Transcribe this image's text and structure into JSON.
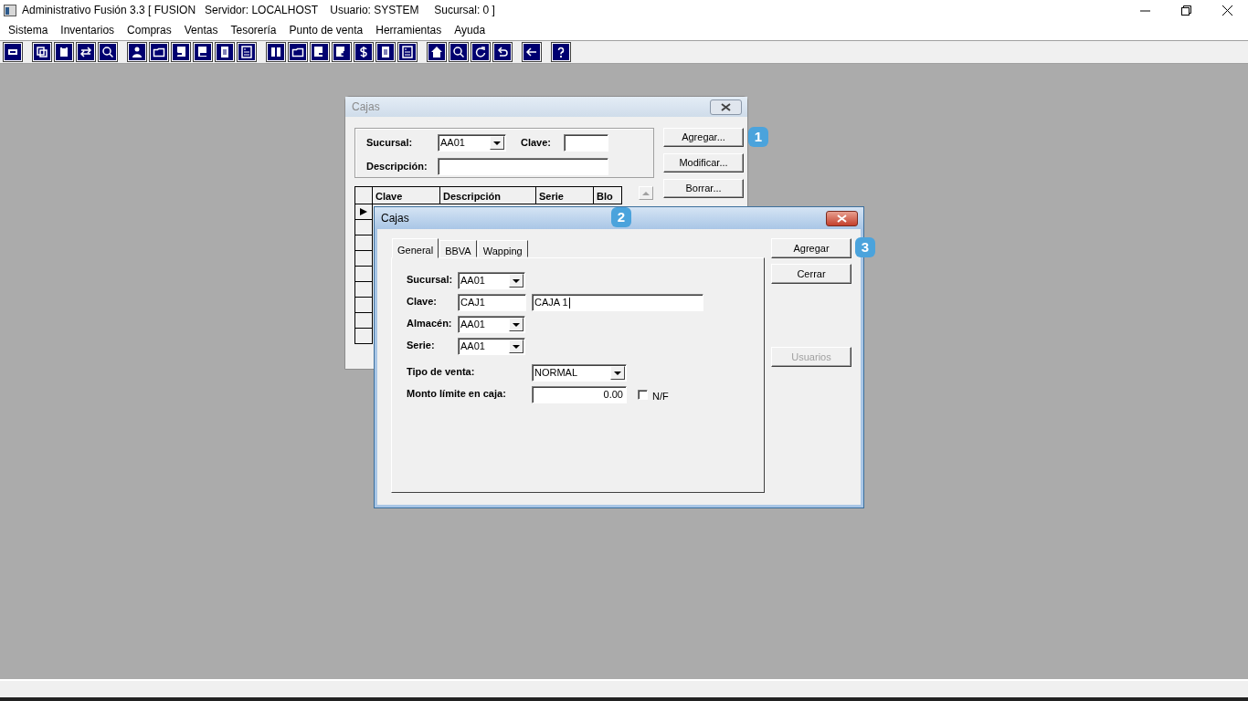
{
  "app": {
    "title": "Administrativo Fusión 3.3 [ FUSION   Servidor: LOCALHOST    Usuario: SYSTEM     Sucursal: 0 ]"
  },
  "menu": [
    "Sistema",
    "Inventarios",
    "Compras",
    "Ventas",
    "Tesorería",
    "Punto de venta",
    "Herramientas",
    "Ayuda"
  ],
  "list_window": {
    "title": "Cajas",
    "active": false,
    "filters": {
      "sucursal_label": "Sucursal:",
      "sucursal_value": "AA01",
      "clave_label": "Clave:",
      "descripcion_label": "Descripción:"
    },
    "buttons": [
      {
        "label": "Agregar...",
        "callout": "1"
      },
      {
        "label": "Modificar..."
      },
      {
        "label": "Borrar..."
      }
    ],
    "grid": {
      "columns": [
        "Clave",
        "Descripción",
        "Serie",
        "Blo"
      ],
      "rows": [
        {
          "current": true
        },
        {
          "current": false
        },
        {
          "current": false
        },
        {
          "current": false
        },
        {
          "current": false
        },
        {
          "current": false
        },
        {
          "current": false
        },
        {
          "current": false
        },
        {
          "current": false
        }
      ]
    }
  },
  "edit_window": {
    "title": "Cajas",
    "active": true,
    "callout": "2",
    "tabs": [
      {
        "label": "General",
        "selected": true
      },
      {
        "label": "BBVA",
        "selected": false
      },
      {
        "label": "Wapping",
        "selected": false
      }
    ],
    "fields": [
      {
        "kind": "select",
        "label": "Sucursal:",
        "value": "AA01"
      },
      {
        "kind": "text_pair",
        "label": "Clave:",
        "value": "CAJ1",
        "value_2": "CAJA 1",
        "focused": true
      },
      {
        "kind": "select",
        "label": "Almacén:",
        "value": "AA01"
      },
      {
        "kind": "select",
        "label": "Serie:",
        "value": "AA01"
      }
    ],
    "sale_fields": [
      {
        "kind": "select",
        "label": "Tipo de venta:",
        "value": "NORMAL"
      },
      {
        "kind": "number_check",
        "label": "Monto límite en caja:",
        "value": "0.00",
        "check_label": "N/F",
        "checked": false
      }
    ],
    "buttons": [
      {
        "label": "Agregar",
        "disabled": false,
        "callout": "3"
      },
      {
        "label": "Cerrar",
        "disabled": false
      },
      {
        "label": "Usuarios",
        "disabled": true
      }
    ]
  }
}
